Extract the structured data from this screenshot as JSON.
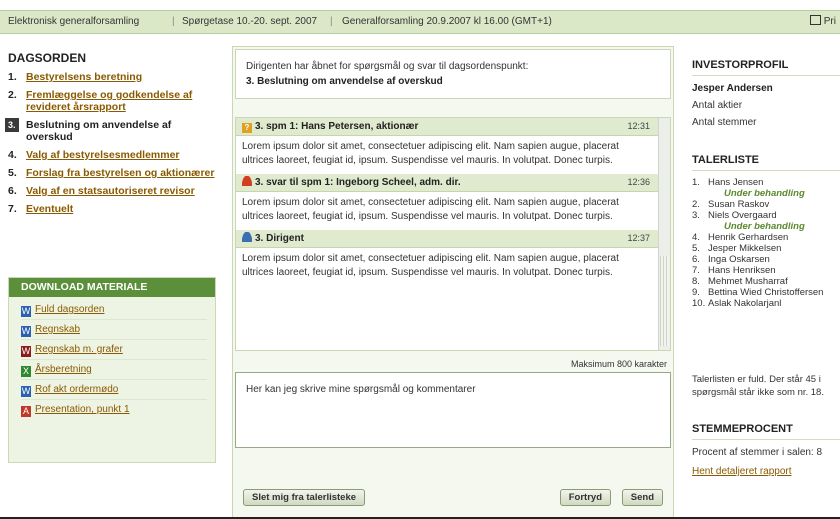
{
  "topbar": {
    "title": "Elektronisk generalforsamling",
    "deadline": "Spørgetase 10.-20. sept. 2007",
    "meeting": "Generalforsamling 20.9.2007 kl 16.00 (GMT+1)",
    "print": "Pri"
  },
  "agenda": {
    "title": "DAGSORDEN",
    "items": [
      {
        "num": "1.",
        "label": "Bestyrelsens beretning"
      },
      {
        "num": "2.",
        "label": "Fremlæggelse og godkendelse af revideret årsrapport"
      },
      {
        "num": "3.",
        "label": "Beslutning om anvendelse af overskud"
      },
      {
        "num": "4.",
        "label": "Valg af bestyrelsesmedlemmer"
      },
      {
        "num": "5.",
        "label": "Forslag fra bestyrelsen og aktionærer"
      },
      {
        "num": "6.",
        "label": "Valg af en statsautoriseret revisor"
      },
      {
        "num": "7.",
        "label": "Eventuelt"
      }
    ]
  },
  "download": {
    "title": "DOWNLOAD MATERIALE",
    "items": [
      {
        "label": "Fuld dagsorden",
        "icon": "word-doc-icon",
        "color": "#2b5fb0"
      },
      {
        "label": "Regnskab",
        "icon": "word-doc-icon",
        "color": "#2b5fb0"
      },
      {
        "label": "Regnskab m. grafer",
        "icon": "word-doc-icon",
        "color": "#8a1c1c"
      },
      {
        "label": "Årsberetning",
        "icon": "excel-doc-icon",
        "color": "#2f8a2f"
      },
      {
        "label": "Rof akt ordermødo",
        "icon": "word-doc-icon",
        "color": "#2b5fb0"
      },
      {
        "label": "Presentation, punkt 1",
        "icon": "pdf-doc-icon",
        "color": "#c0392b"
      }
    ]
  },
  "notice": {
    "line1": "Dirigenten har åbnet for spørgsmål og svar til dagsordenspunkt:",
    "line2": "3. Beslutning om anvendelse af overskud"
  },
  "messages": [
    {
      "title": "3. spm 1: Hans Petersen, aktionær",
      "time": "12:31",
      "icon": "question-icon",
      "body": "Lorem ipsum dolor sit amet, consectetuer adipiscing elit. Nam sapien augue, placerat ultrices laoreet, feugiat id, ipsum. Suspendisse vel mauris. In volutpat. Donec turpis."
    },
    {
      "title": "3. svar til spm 1: Ingeborg Scheel, adm. dir.",
      "time": "12:36",
      "icon": "answer-person-icon",
      "body": "Lorem ipsum dolor sit amet, consectetuer adipiscing elit. Nam sapien augue, placerat ultrices laoreet, feugiat id, ipsum. Suspendisse vel mauris. In volutpat. Donec turpis."
    },
    {
      "title": "3. Dirigent",
      "time": "12:37",
      "icon": "moderator-person-icon",
      "body": "Lorem ipsum dolor sit amet, consectetuer adipiscing elit. Nam sapien augue, placerat ultrices laoreet, feugiat id, ipsum. Suspendisse vel mauris. In volutpat. Donec turpis."
    }
  ],
  "composer": {
    "max_label": "Maksimum 800 karakter",
    "placeholder": "Her kan jeg skrive mine spørgsmål og kommentarer"
  },
  "buttons": {
    "remove": "Slet mig fra talerlisteke",
    "regret": "Fortryd",
    "send": "Send"
  },
  "investor": {
    "title": "INVESTORPROFIL",
    "name": "Jesper Andersen",
    "shares_label": "Antal aktier",
    "votes_label": "Antal stemmer"
  },
  "speakers": {
    "title": "TALERLISTE",
    "items": [
      {
        "num": "1.",
        "name": "Hans Jensen",
        "status": "Under behandling"
      },
      {
        "num": "2.",
        "name": "Susan Raskov",
        "status": ""
      },
      {
        "num": "3.",
        "name": "Niels Overgaard",
        "status": "Under behandling"
      },
      {
        "num": "4.",
        "name": "Henrik Gerhardsen",
        "status": ""
      },
      {
        "num": "5.",
        "name": "Jesper Mikkelsen",
        "status": ""
      },
      {
        "num": "6.",
        "name": "Inga Oskarsen",
        "status": ""
      },
      {
        "num": "7.",
        "name": "Hans Henriksen",
        "status": ""
      },
      {
        "num": "8.",
        "name": "Mehmet Musharraf",
        "status": ""
      },
      {
        "num": "9.",
        "name": "Bettina Wied Christoffersen",
        "status": ""
      },
      {
        "num": "10.",
        "name": "Aslak Nakolarjanl",
        "status": ""
      }
    ],
    "note_line1": "Talerlisten er fuld. Der står 45 i",
    "note_line2": "spørgsmål står ikke som nr. 18."
  },
  "vote": {
    "title": "STEMMEPROCENT",
    "text": "Procent af stemmer i salen: 8",
    "link": "Hent detaljeret rapport"
  }
}
